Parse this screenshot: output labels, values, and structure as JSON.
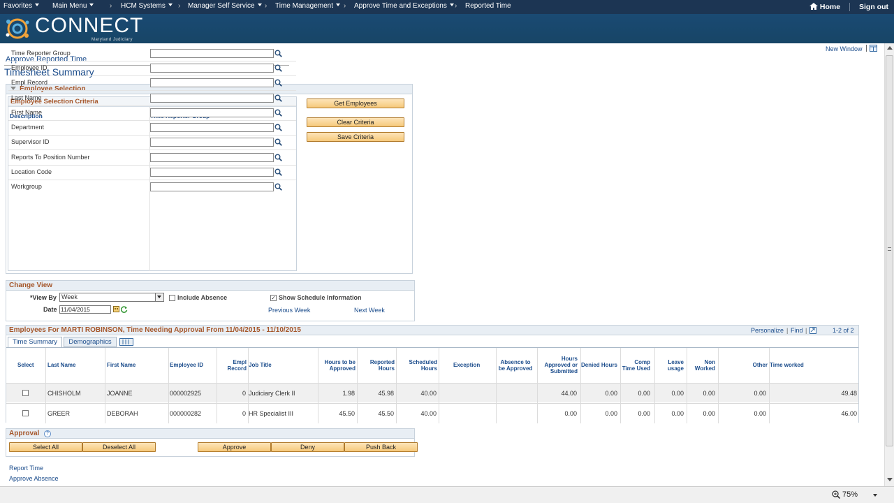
{
  "nav": {
    "favorites": "Favorites",
    "main_menu": "Main Menu",
    "hcm": "HCM Systems",
    "mss": "Manager Self Service",
    "time_mgmt": "Time Management",
    "approve": "Approve Time and Exceptions",
    "reported": "Reported Time",
    "home": "Home",
    "signout": "Sign out"
  },
  "banner": {
    "logo": "CONNECT",
    "sub": "Maryland Judiciary"
  },
  "page": {
    "new_window": "New Window",
    "title": "Approve Reported Time",
    "subtitle": "Timesheet Summary"
  },
  "employee_selection": {
    "header": "Employee Selection",
    "criteria_header": "Employee Selection Criteria",
    "col_desc": "Description",
    "col_group": "Time Reporter Group",
    "rows": [
      "Time Reporter Group",
      "Employee ID",
      "Empl Record",
      "Last Name",
      "First Name",
      "Department",
      "Supervisor ID",
      "Reports To Position Number",
      "Location Code",
      "Workgroup"
    ],
    "btn_get": "Get Employees",
    "btn_clear": "Clear Criteria",
    "btn_save": "Save Criteria"
  },
  "change_view": {
    "header": "Change View",
    "view_by_label": "*View By",
    "view_by_value": "Week",
    "include_absence": "Include Absence",
    "show_schedule": "Show Schedule Information",
    "date_label": "Date",
    "date_value": "11/04/2015",
    "prev_week": "Previous Week",
    "next_week": "Next Week"
  },
  "employees": {
    "header": "Employees For MARTI ROBINSON, Time Needing Approval From 11/04/2015 - 11/10/2015",
    "personalize": "Personalize",
    "find": "Find",
    "count": "1-2 of 2",
    "tab_summary": "Time Summary",
    "tab_demo": "Demographics",
    "columns": {
      "select": "Select",
      "last": "Last Name",
      "first": "First Name",
      "empid": "Employee ID",
      "empl_rec_1": "Empl",
      "empl_rec_2": "Record",
      "job": "Job Title",
      "htba_1": "Hours to be",
      "htba_2": "Approved",
      "rep_1": "Reported",
      "rep_2": "Hours",
      "sch_1": "Scheduled",
      "sch_2": "Hours",
      "exception": "Exception",
      "abs_1": "Absence to",
      "abs_2": "be Approved",
      "has_1": "Hours",
      "has_2": "Approved or",
      "has_3": "Submitted",
      "denied": "Denied Hours",
      "comp_1": "Comp",
      "comp_2": "Time Used",
      "leave_1": "Leave",
      "leave_2": "usage",
      "non_1": "Non",
      "non_2": "Worked",
      "other": "Other",
      "worked": "Time worked"
    },
    "rows": [
      {
        "last": "CHISHOLM",
        "first": "JOANNE",
        "empid": "000002925",
        "rec": "0",
        "job": "Judiciary Clerk II",
        "htba": "1.98",
        "rep": "45.98",
        "sch": "40.00",
        "has": "44.00",
        "denied": "0.00",
        "comp": "0.00",
        "leave": "0.00",
        "non": "0.00",
        "other": "0.00",
        "worked": "49.48"
      },
      {
        "last": "GREER",
        "first": "DEBORAH",
        "empid": "000000282",
        "rec": "0",
        "job": "HR Specialist III",
        "htba": "45.50",
        "rep": "45.50",
        "sch": "40.00",
        "has": "0.00",
        "denied": "0.00",
        "comp": "0.00",
        "leave": "0.00",
        "non": "0.00",
        "other": "0.00",
        "worked": "46.00"
      }
    ]
  },
  "approval": {
    "header": "Approval",
    "select_all": "Select All",
    "deselect_all": "Deselect All",
    "approve": "Approve",
    "deny": "Deny",
    "push_back": "Push Back"
  },
  "footer_links": [
    "Report Time",
    "Approve Absence"
  ],
  "status": {
    "zoom": "75%"
  },
  "colors": {
    "nav": "#1c3553",
    "banner": "#1a4a73",
    "accent": "#a5562a",
    "link": "#1c4d8c"
  }
}
